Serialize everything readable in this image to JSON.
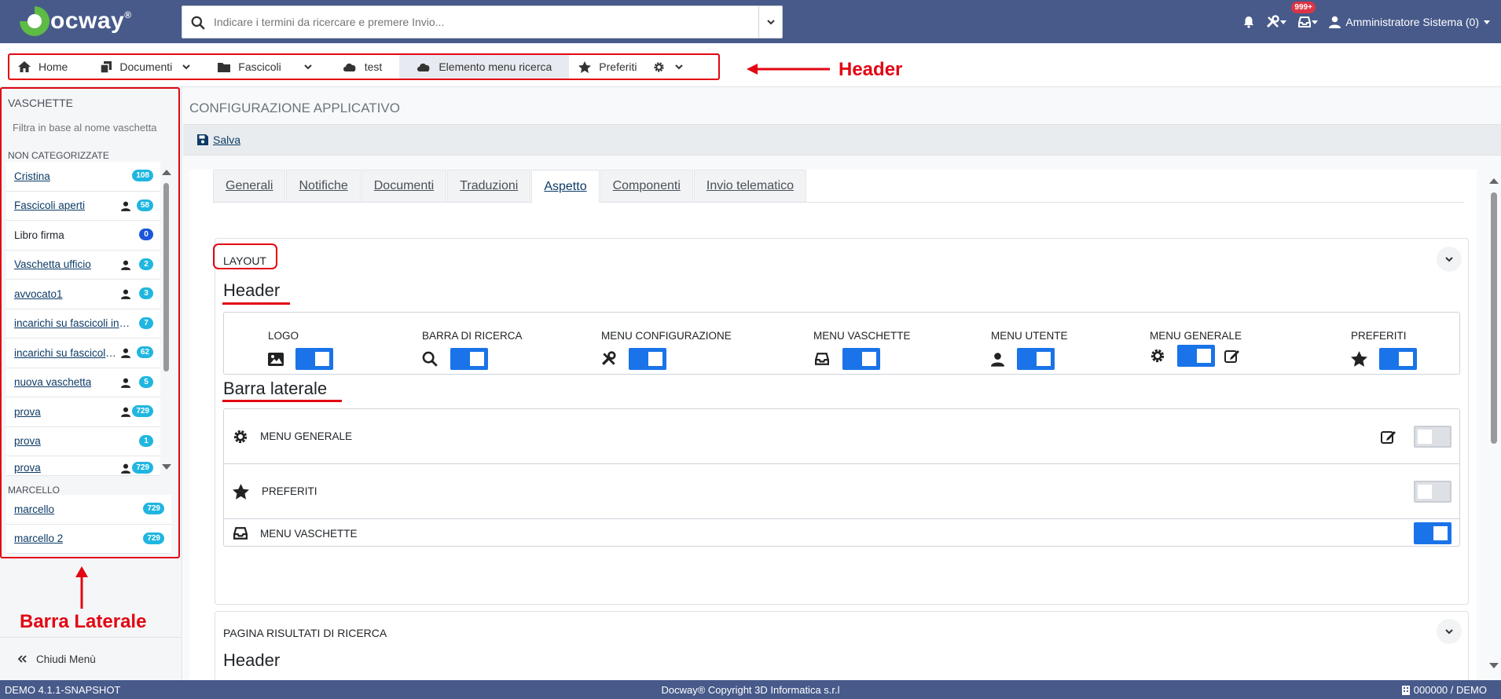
{
  "header": {
    "logo_text": "ocway",
    "logo_reg": "®",
    "search_placeholder": "Indicare i termini da ricercare e premere Invio...",
    "notif_badge": "999+",
    "user_name": "Amministratore Sistema (0)"
  },
  "nav": {
    "items": [
      {
        "label": "Home",
        "icon": "home-icon"
      },
      {
        "label": "Documenti",
        "icon": "copy-icon"
      },
      {
        "label": "Fascicoli",
        "icon": "folder-icon"
      },
      {
        "label": "test",
        "icon": "cloud-icon"
      },
      {
        "label": "Elemento menu ricerca",
        "icon": "cloud-icon"
      },
      {
        "label": "Preferiti",
        "icon": "star-icon"
      }
    ],
    "annotation": "Header"
  },
  "sidebar": {
    "title": "VASCHETTE",
    "filter_placeholder": "Filtra in base al nome vaschetta",
    "group1": "NON CATEGORIZZATE",
    "items1": [
      {
        "label": "Cristina",
        "count": "108"
      },
      {
        "label": "Fascicoli aperti",
        "count": "58"
      },
      {
        "label": "Libro firma",
        "count": "0"
      },
      {
        "label": "Vaschetta ufficio",
        "count": "2"
      },
      {
        "label": "avvocato1",
        "count": "3"
      },
      {
        "label": "incarichi su fascicoli in ...",
        "count": "7"
      },
      {
        "label": "incarichi su fascicoli ...",
        "count": "62"
      },
      {
        "label": "nuova vaschetta",
        "count": "5"
      },
      {
        "label": "prova",
        "count": "729"
      },
      {
        "label": "prova",
        "count": "1"
      },
      {
        "label": "prova",
        "count": "729"
      }
    ],
    "group2": "MARCELLO",
    "items2": [
      {
        "label": "marcello",
        "count": "729"
      },
      {
        "label": "marcello 2",
        "count": "729"
      }
    ],
    "close_label": "Chiudi Menù",
    "annotation": "Barra Laterale"
  },
  "main": {
    "page_title": "CONFIGURAZIONE APPLICATIVO",
    "save_label": "Salva",
    "tabs": [
      "Generali",
      "Notifiche",
      "Documenti",
      "Traduzioni",
      "Aspetto",
      "Componenti",
      "Invio telematico"
    ],
    "active_tab": "Aspetto",
    "layout_card": {
      "title": "LAYOUT",
      "header_section": "Header",
      "header_options": [
        {
          "label": "LOGO",
          "icon": "image-icon",
          "on": true
        },
        {
          "label": "BARRA DI RICERCA",
          "icon": "search-icon",
          "on": true
        },
        {
          "label": "MENU CONFIGURAZIONE",
          "icon": "tools-icon",
          "on": true
        },
        {
          "label": "MENU VASCHETTE",
          "icon": "inbox-icon",
          "on": true
        },
        {
          "label": "MENU UTENTE",
          "icon": "user-icon",
          "on": true
        },
        {
          "label": "MENU GENERALE",
          "icon": "gear-icon",
          "on": true
        },
        {
          "label": "PREFERITI",
          "icon": "star-icon",
          "on": true
        }
      ],
      "sidebar_section": "Barra laterale",
      "sidebar_options": [
        {
          "label": "MENU GENERALE",
          "icon": "gear-icon",
          "on": false
        },
        {
          "label": "PREFERITI",
          "icon": "star-icon",
          "on": false
        },
        {
          "label": "MENU VASCHETTE",
          "icon": "inbox-icon",
          "on": true
        }
      ]
    },
    "results_card": {
      "title": "PAGINA RISULTATI DI RICERCA",
      "header_section": "Header"
    }
  },
  "footer": {
    "version": "DEMO 4.1.1-SNAPSHOT",
    "copyright": "Docway® Copyright 3D Informatica s.r.l",
    "aoo": "000000 / DEMO"
  },
  "colors": {
    "topbar": "#475a8a",
    "accent": "#1a73e8",
    "annotation": "#e30613"
  }
}
